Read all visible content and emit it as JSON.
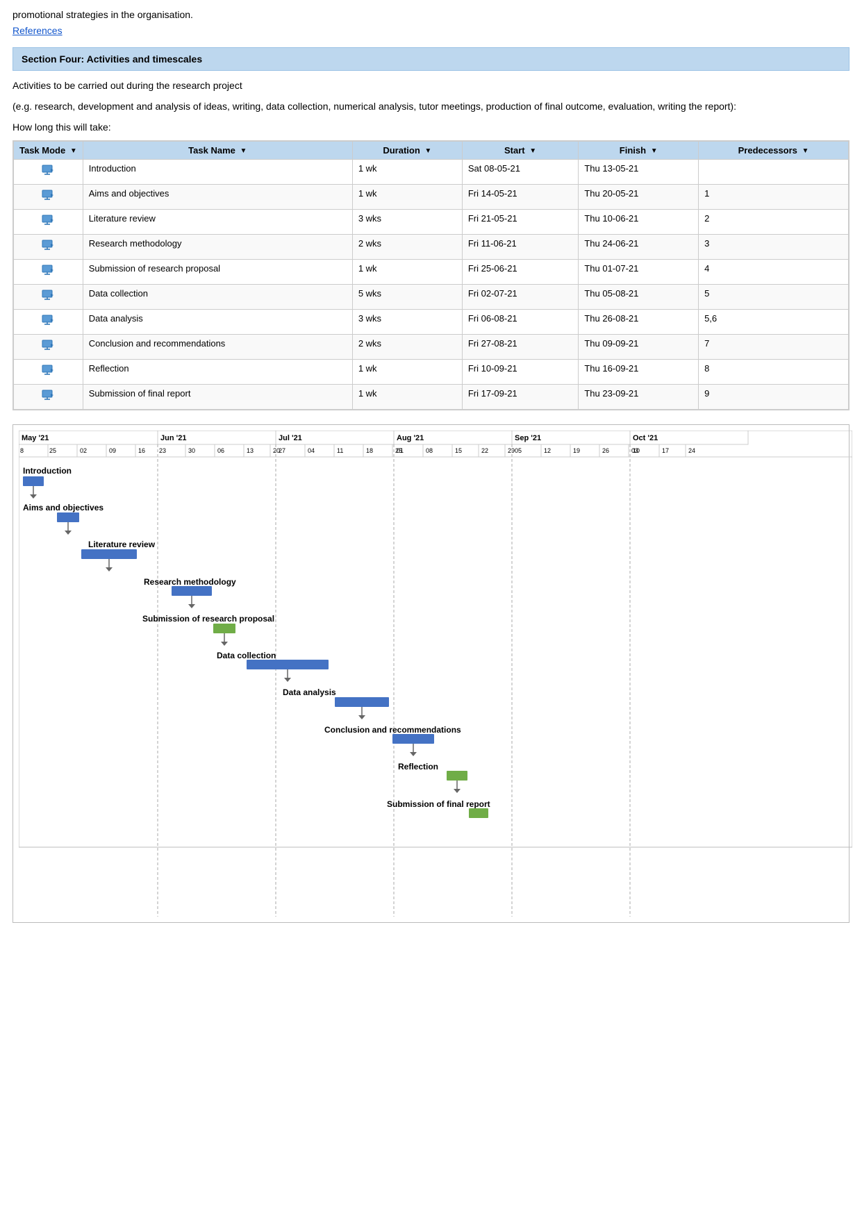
{
  "intro": {
    "text": "promotional strategies in the organisation.",
    "references_label": "References"
  },
  "section": {
    "title": "Section Four: Activities and timescales",
    "desc1": "Activities to be carried out during the research project",
    "desc2": "(e.g. research, development and analysis of ideas, writing, data collection, numerical analysis, tutor meetings, production of final outcome, evaluation, writing the report):",
    "desc3": "How long this will take:"
  },
  "table": {
    "headers": [
      "Task Mode",
      "Task Name",
      "Duration",
      "Start",
      "Finish",
      "Predecessors"
    ],
    "rows": [
      {
        "mode": "⇒",
        "name": "Introduction",
        "duration": "1 wk",
        "start": "Sat 08-05-21",
        "finish": "Thu 13-05-21",
        "predecessors": ""
      },
      {
        "mode": "⇒",
        "name": "Aims and objectives",
        "duration": "1 wk",
        "start": "Fri 14-05-21",
        "finish": "Thu 20-05-21",
        "predecessors": "1"
      },
      {
        "mode": "⇒",
        "name": "Literature review",
        "duration": "3 wks",
        "start": "Fri 21-05-21",
        "finish": "Thu 10-06-21",
        "predecessors": "2"
      },
      {
        "mode": "⇒",
        "name": "Research methodology",
        "duration": "2 wks",
        "start": "Fri 11-06-21",
        "finish": "Thu 24-06-21",
        "predecessors": "3"
      },
      {
        "mode": "⇒",
        "name": "Submission of research proposal",
        "duration": "1 wk",
        "start": "Fri 25-06-21",
        "finish": "Thu 01-07-21",
        "predecessors": "4"
      },
      {
        "mode": "⇒",
        "name": "Data collection",
        "duration": "5 wks",
        "start": "Fri 02-07-21",
        "finish": "Thu 05-08-21",
        "predecessors": "5"
      },
      {
        "mode": "⇒",
        "name": "Data analysis",
        "duration": "3 wks",
        "start": "Fri 06-08-21",
        "finish": "Thu 26-08-21",
        "predecessors": "5,6"
      },
      {
        "mode": "⇒",
        "name": "Conclusion and recommendations",
        "duration": "2 wks",
        "start": "Fri 27-08-21",
        "finish": "Thu 09-09-21",
        "predecessors": "7"
      },
      {
        "mode": "⇒",
        "name": "Reflection",
        "duration": "1 wk",
        "start": "Fri 10-09-21",
        "finish": "Thu 16-09-21",
        "predecessors": "8"
      },
      {
        "mode": "⇒",
        "name": "Submission of final report",
        "duration": "1 wk",
        "start": "Fri 17-09-21",
        "finish": "Thu 23-09-21",
        "predecessors": "9"
      }
    ]
  },
  "chart": {
    "months": [
      "May '21",
      "Jun '21",
      "Jul '21",
      "Aug '21",
      "Sep '21",
      "Oct '21"
    ],
    "dates": [
      "8",
      "25",
      "02",
      "09",
      "16",
      "23",
      "30",
      "06",
      "13",
      "20",
      "27",
      "04",
      "11",
      "18",
      "25",
      "01",
      "08",
      "15",
      "22",
      "29",
      "05",
      "12",
      "19",
      "26",
      "03",
      "10",
      "17",
      "24"
    ],
    "tasks": [
      {
        "name": "Introduction",
        "left_pct": 0,
        "width_pct": 8
      },
      {
        "name": "Aims and objectives",
        "left_pct": 8,
        "width_pct": 8
      },
      {
        "name": "Literature review",
        "left_pct": 16,
        "width_pct": 13
      },
      {
        "name": "Research methodology",
        "left_pct": 29,
        "width_pct": 10
      },
      {
        "name": "Submission of research proposal",
        "left_pct": 39,
        "width_pct": 6
      },
      {
        "name": "Data collection",
        "left_pct": 45,
        "width_pct": 18
      },
      {
        "name": "Data analysis",
        "left_pct": 55,
        "width_pct": 13
      },
      {
        "name": "Conclusion and recommendations",
        "left_pct": 62,
        "width_pct": 10
      },
      {
        "name": "Reflection",
        "left_pct": 72,
        "width_pct": 6
      },
      {
        "name": "Submission of final report",
        "left_pct": 78,
        "width_pct": 6
      }
    ]
  }
}
